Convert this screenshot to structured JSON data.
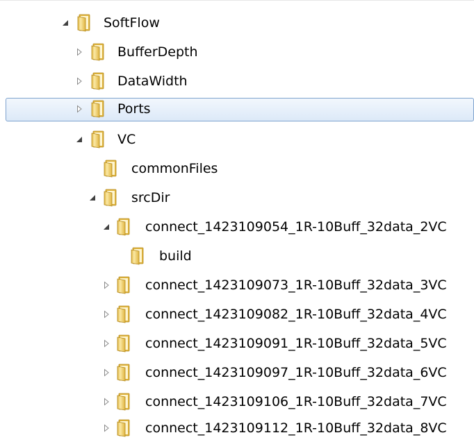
{
  "tree": {
    "items": [
      {
        "label": "SoftFlow",
        "state": "expanded",
        "selected": false
      },
      {
        "label": "BufferDepth",
        "state": "collapsed",
        "selected": false
      },
      {
        "label": "DataWidth",
        "state": "collapsed",
        "selected": false
      },
      {
        "label": "Ports",
        "state": "collapsed",
        "selected": true
      },
      {
        "label": "VC",
        "state": "expanded",
        "selected": false
      },
      {
        "label": "commonFiles",
        "state": "leaf",
        "selected": false
      },
      {
        "label": "srcDir",
        "state": "expanded",
        "selected": false
      },
      {
        "label": "connect_1423109054_1R-10Buff_32data_2VC",
        "state": "expanded",
        "selected": false
      },
      {
        "label": "build",
        "state": "leaf",
        "selected": false
      },
      {
        "label": "connect_1423109073_1R-10Buff_32data_3VC",
        "state": "collapsed",
        "selected": false
      },
      {
        "label": "connect_1423109082_1R-10Buff_32data_4VC",
        "state": "collapsed",
        "selected": false
      },
      {
        "label": "connect_1423109091_1R-10Buff_32data_5VC",
        "state": "collapsed",
        "selected": false
      },
      {
        "label": "connect_1423109097_1R-10Buff_32data_6VC",
        "state": "collapsed",
        "selected": false
      },
      {
        "label": "connect_1423109106_1R-10Buff_32data_7VC",
        "state": "collapsed",
        "selected": false
      },
      {
        "label": "connect_1423109112_1R-10Buff_32data_8VC",
        "state": "collapsed",
        "selected": false
      }
    ],
    "icons": {
      "folder": "folder-icon",
      "expanded": "expanded-triangle-icon",
      "collapsed": "collapsed-triangle-icon"
    },
    "colors": {
      "selection_border": "#7da2ce",
      "selection_top": "#f2f7fd",
      "selection_bottom": "#dce9f8",
      "folder_light": "#fbe9a6",
      "folder_dark": "#e0b540",
      "glyph": "#8a8a8a"
    }
  }
}
